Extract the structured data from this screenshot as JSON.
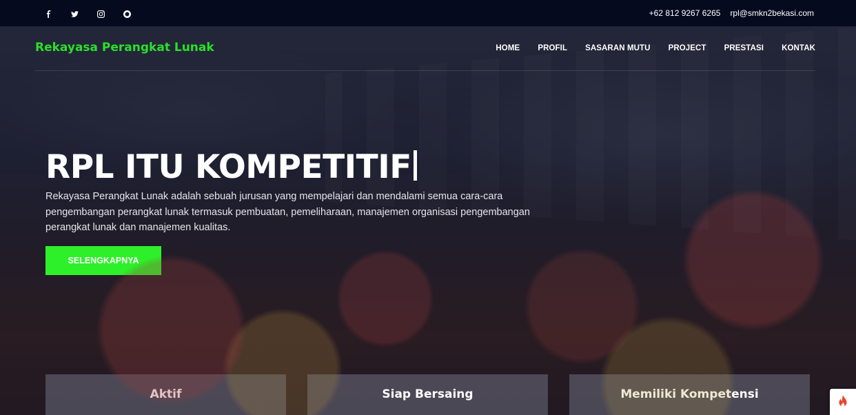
{
  "topbar": {
    "social": [
      {
        "icon": "facebook-icon",
        "label": "Facebook"
      },
      {
        "icon": "twitter-icon",
        "label": "Twitter"
      },
      {
        "icon": "instagram-icon",
        "label": "Instagram"
      },
      {
        "icon": "google-icon",
        "label": "Google"
      }
    ],
    "phone": "+62 812 9267 6265",
    "email": "rpl@smkn2bekasi.com"
  },
  "navbar": {
    "brand": "Rekayasa Perangkat Lunak",
    "brand_color": "#2ae02a",
    "menu": [
      "HOME",
      "PROFIL",
      "SASARAN MUTU",
      "PROJECT",
      "PRESTASI",
      "KONTAK"
    ]
  },
  "hero": {
    "headline": "RPL ITU KOMPETITIF",
    "description": "Rekayasa Perangkat Lunak adalah sebuah jurusan yang mempelajari dan mendalami semua cara-cara pengembangan perangkat lunak termasuk pembuatan, pemeliharaan, manajemen organisasi pengembangan perangkat lunak dan manajemen kualitas.",
    "cta_label": "SELENGKAPNYA",
    "cta_color": "#2ef02a"
  },
  "features": [
    "Aktif",
    "Siap Bersaing",
    "Memiliki Kompetensi"
  ],
  "corner_badge": {
    "icon": "flame-icon"
  }
}
